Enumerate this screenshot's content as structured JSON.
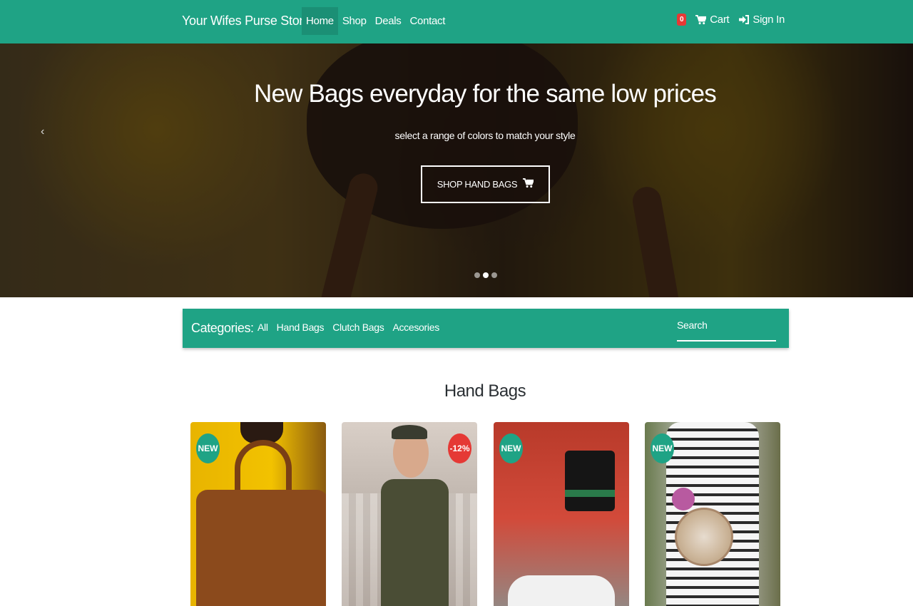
{
  "navbar": {
    "brand": "Your Wifes Purse Store",
    "links": [
      "Home",
      "Shop",
      "Deals",
      "Contact"
    ],
    "active_link": "Home",
    "cart_count": "0",
    "cart_label": "Cart",
    "signin_label": "Sign In"
  },
  "hero": {
    "title": "New Bags everyday for the same low prices",
    "subtitle": "select a range of colors to match your style",
    "button_label": "SHOP HAND BAGS",
    "prev_arrow": "‹",
    "active_slide": 2,
    "slide_count": 3
  },
  "categories": {
    "label": "Categories:",
    "items": [
      "All",
      "Hand Bags",
      "Clutch Bags",
      "Accesories"
    ],
    "search_placeholder": "Search"
  },
  "section": {
    "title": "Hand Bags"
  },
  "products": [
    {
      "badge": "NEW",
      "badge_type": "new"
    },
    {
      "badge": "-12%",
      "badge_type": "sale"
    },
    {
      "badge": "NEW",
      "badge_type": "new"
    },
    {
      "badge": "NEW",
      "badge_type": "new"
    }
  ],
  "colors": {
    "primary": "#1fa385",
    "primary_dark": "#1b8f75",
    "sale": "#e53935"
  },
  "icons": {
    "cart": "shopping-cart-icon",
    "signin": "sign-in-icon"
  }
}
